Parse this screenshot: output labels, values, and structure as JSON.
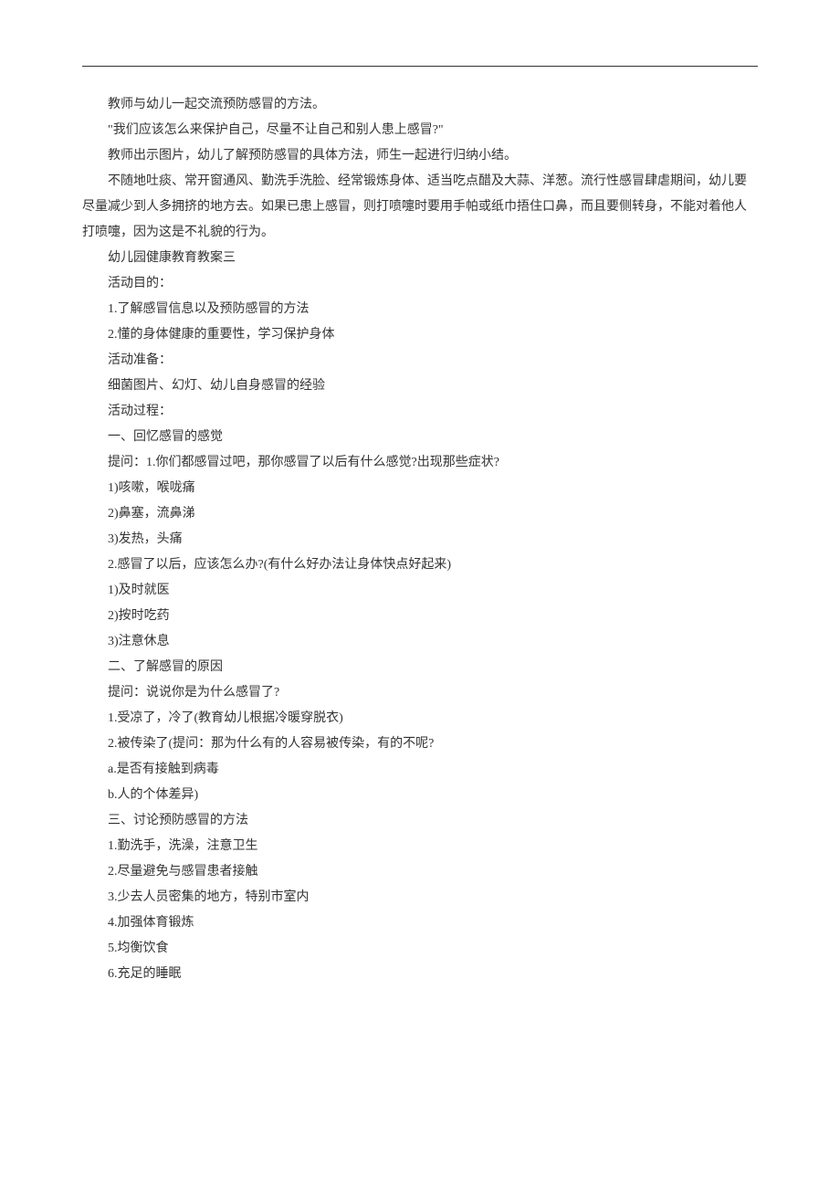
{
  "lines": [
    "教师与幼儿一起交流预防感冒的方法。",
    "\"我们应该怎么来保护自己，尽量不让自己和别人患上感冒?\"",
    "教师出示图片，幼儿了解预防感冒的具体方法，师生一起进行归纳小结。",
    "不随地吐痰、常开窗通风、勤洗手洗脸、经常锻炼身体、适当吃点醋及大蒜、洋葱。流行性感冒肆虐期间，幼儿要尽量减少到人多拥挤的地方去。如果已患上感冒，则打喷嚏时要用手帕或纸巾捂住口鼻，而且要侧转身，不能对着他人打喷嚏，因为这是不礼貌的行为。",
    "幼儿园健康教育教案三",
    "活动目的：",
    "1.了解感冒信息以及预防感冒的方法",
    "2.懂的身体健康的重要性，学习保护身体",
    "活动准备：",
    "细菌图片、幻灯、幼儿自身感冒的经验",
    "活动过程：",
    "一、回忆感冒的感觉",
    "提问：1.你们都感冒过吧，那你感冒了以后有什么感觉?出现那些症状?",
    "1)咳嗽，喉咙痛",
    "2)鼻塞，流鼻涕",
    "3)发热，头痛",
    "2.感冒了以后，应该怎么办?(有什么好办法让身体快点好起来)",
    "1)及时就医",
    "2)按时吃药",
    "3)注意休息",
    "二、了解感冒的原因",
    "提问：说说你是为什么感冒了?",
    "1.受凉了，冷了(教育幼儿根据冷暖穿脱衣)",
    "2.被传染了(提问：那为什么有的人容易被传染，有的不呢?",
    "a.是否有接触到病毒",
    "b.人的个体差异)",
    "三、讨论预防感冒的方法",
    "1.勤洗手，洗澡，注意卫生",
    "2.尽量避免与感冒患者接触",
    "3.少去人员密集的地方，特别市室内",
    "4.加强体育锻炼",
    "5.均衡饮食",
    "6.充足的睡眠"
  ],
  "hangIndices": [
    3
  ]
}
